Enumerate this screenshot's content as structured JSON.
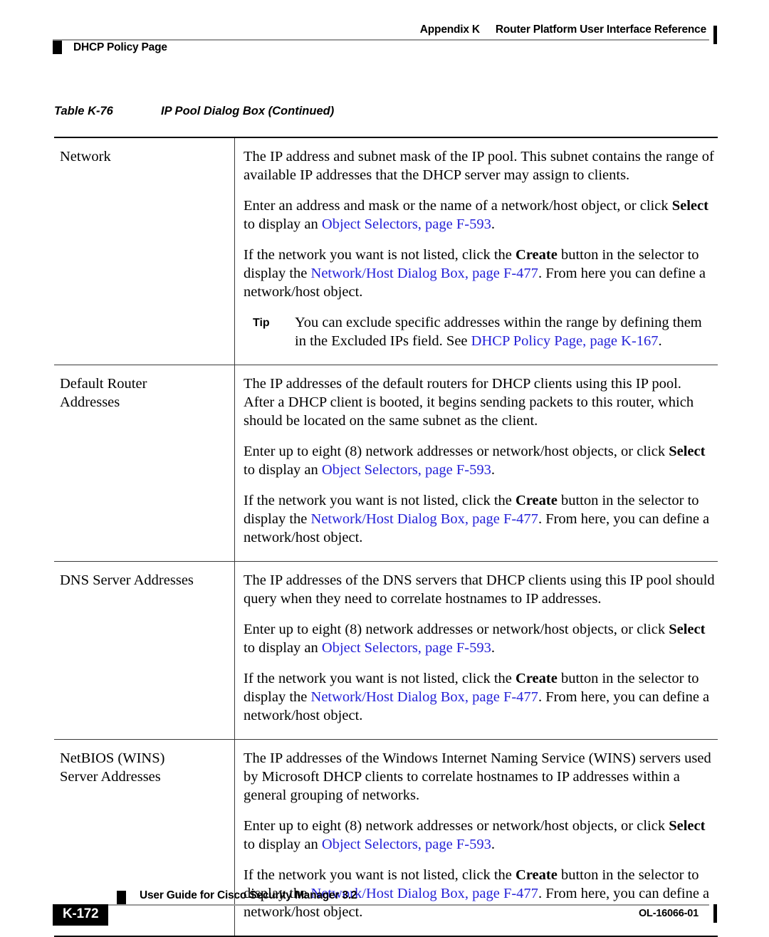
{
  "header": {
    "appendix": "Appendix K",
    "title": "Router Platform User Interface Reference",
    "section": "DHCP Policy Page"
  },
  "caption": {
    "number": "Table K-76",
    "title": "IP Pool Dialog Box (Continued)"
  },
  "links": {
    "object_selectors": "Object Selectors, page F-593",
    "network_host_dialog": "Network/Host Dialog Box, page F-477",
    "dhcp_policy_page": "DHCP Policy Page, page K-167"
  },
  "emphasis": {
    "select": "Select",
    "create": "Create",
    "tip": "Tip"
  },
  "rows": [
    {
      "label_lines": [
        "Network"
      ],
      "paragraphs": [
        {
          "type": "plain",
          "parts": [
            {
              "text": "The IP address and subnet mask of the IP pool. This subnet contains the range of available IP addresses that the DHCP server may assign to clients."
            }
          ]
        },
        {
          "type": "plain",
          "parts": [
            {
              "text": "Enter an address and mask or the name of a network/host object, or click "
            },
            {
              "text": "Select",
              "style": "bold"
            },
            {
              "text": " to display an "
            },
            {
              "text": "Object Selectors, page F-593",
              "style": "link"
            },
            {
              "text": "."
            }
          ]
        },
        {
          "type": "plain",
          "parts": [
            {
              "text": "If the network you want is not listed, click the "
            },
            {
              "text": "Create",
              "style": "bold"
            },
            {
              "text": " button in the selector to display the "
            },
            {
              "text": "Network/Host Dialog Box, page F-477",
              "style": "link"
            },
            {
              "text": ". From here you can define a network/host object."
            }
          ]
        },
        {
          "type": "tip",
          "label": "Tip",
          "parts": [
            {
              "text": "You can exclude specific addresses within the range by defining them in the Excluded IPs field. See "
            },
            {
              "text": "DHCP Policy Page, page K-167",
              "style": "link"
            },
            {
              "text": "."
            }
          ]
        }
      ]
    },
    {
      "label_lines": [
        "Default Router",
        "Addresses"
      ],
      "paragraphs": [
        {
          "type": "plain",
          "parts": [
            {
              "text": "The IP addresses of the default routers for DHCP clients using this IP pool. After a DHCP client is booted, it begins sending packets to this router, which should be located on the same subnet as the client."
            }
          ]
        },
        {
          "type": "plain",
          "parts": [
            {
              "text": "Enter up to eight (8) network addresses or network/host objects, or click "
            },
            {
              "text": "Select",
              "style": "bold"
            },
            {
              "text": " to display an "
            },
            {
              "text": "Object Selectors, page F-593",
              "style": "link"
            },
            {
              "text": "."
            }
          ]
        },
        {
          "type": "plain",
          "parts": [
            {
              "text": "If the network you want is not listed, click the "
            },
            {
              "text": "Create",
              "style": "bold"
            },
            {
              "text": " button in the selector to display the "
            },
            {
              "text": "Network/Host Dialog Box, page F-477",
              "style": "link"
            },
            {
              "text": ". From here, you can define a network/host object."
            }
          ]
        }
      ]
    },
    {
      "label_lines": [
        "DNS Server Addresses"
      ],
      "paragraphs": [
        {
          "type": "plain",
          "parts": [
            {
              "text": "The IP addresses of the DNS servers that DHCP clients using this IP pool should query when they need to correlate hostnames to IP addresses."
            }
          ]
        },
        {
          "type": "plain",
          "parts": [
            {
              "text": "Enter up to eight (8) network addresses or network/host objects, or click "
            },
            {
              "text": "Select",
              "style": "bold"
            },
            {
              "text": " to display an "
            },
            {
              "text": "Object Selectors, page F-593",
              "style": "link"
            },
            {
              "text": "."
            }
          ]
        },
        {
          "type": "plain",
          "parts": [
            {
              "text": "If the network you want is not listed, click the "
            },
            {
              "text": "Create",
              "style": "bold"
            },
            {
              "text": " button in the selector to display the "
            },
            {
              "text": "Network/Host Dialog Box, page F-477",
              "style": "link"
            },
            {
              "text": ". From here, you can define a network/host object."
            }
          ]
        }
      ]
    },
    {
      "label_lines": [
        "NetBIOS (WINS)",
        "Server Addresses"
      ],
      "paragraphs": [
        {
          "type": "plain",
          "parts": [
            {
              "text": "The IP addresses of the Windows Internet Naming Service (WINS) servers used by Microsoft DHCP clients to correlate hostnames to IP addresses within a general grouping of networks."
            }
          ]
        },
        {
          "type": "plain",
          "parts": [
            {
              "text": "Enter up to eight (8) network addresses or network/host objects, or click "
            },
            {
              "text": "Select",
              "style": "bold"
            },
            {
              "text": " to display an "
            },
            {
              "text": "Object Selectors, page F-593",
              "style": "link"
            },
            {
              "text": "."
            }
          ]
        },
        {
          "type": "plain",
          "parts": [
            {
              "text": "If the network you want is not listed, click the "
            },
            {
              "text": "Create",
              "style": "bold"
            },
            {
              "text": " button in the selector to display the "
            },
            {
              "text": "Network/Host Dialog Box, page F-477",
              "style": "link"
            },
            {
              "text": ". From here, you can define a network/host object."
            }
          ]
        }
      ]
    }
  ],
  "footer": {
    "guide": "User Guide for Cisco Security Manager 3.2",
    "page_number": "K-172",
    "doc_id": "OL-16066-01"
  },
  "colors": {
    "link": "#2522d8",
    "rule": "#9a9a9a",
    "text": "#000000"
  }
}
